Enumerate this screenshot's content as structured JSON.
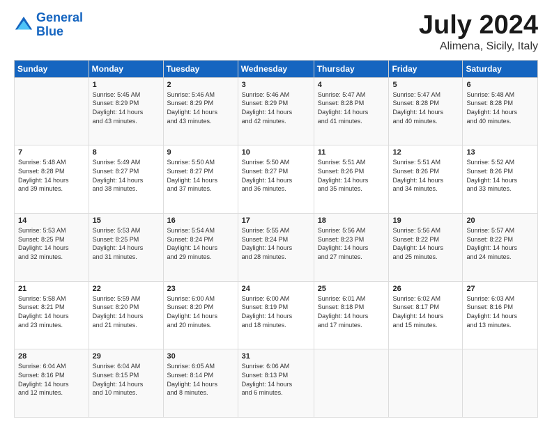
{
  "header": {
    "logo_line1": "General",
    "logo_line2": "Blue",
    "title": "July 2024",
    "subtitle": "Alimena, Sicily, Italy"
  },
  "weekdays": [
    "Sunday",
    "Monday",
    "Tuesday",
    "Wednesday",
    "Thursday",
    "Friday",
    "Saturday"
  ],
  "weeks": [
    [
      {
        "day": "",
        "text": ""
      },
      {
        "day": "1",
        "text": "Sunrise: 5:45 AM\nSunset: 8:29 PM\nDaylight: 14 hours\nand 43 minutes."
      },
      {
        "day": "2",
        "text": "Sunrise: 5:46 AM\nSunset: 8:29 PM\nDaylight: 14 hours\nand 43 minutes."
      },
      {
        "day": "3",
        "text": "Sunrise: 5:46 AM\nSunset: 8:29 PM\nDaylight: 14 hours\nand 42 minutes."
      },
      {
        "day": "4",
        "text": "Sunrise: 5:47 AM\nSunset: 8:28 PM\nDaylight: 14 hours\nand 41 minutes."
      },
      {
        "day": "5",
        "text": "Sunrise: 5:47 AM\nSunset: 8:28 PM\nDaylight: 14 hours\nand 40 minutes."
      },
      {
        "day": "6",
        "text": "Sunrise: 5:48 AM\nSunset: 8:28 PM\nDaylight: 14 hours\nand 40 minutes."
      }
    ],
    [
      {
        "day": "7",
        "text": "Sunrise: 5:48 AM\nSunset: 8:28 PM\nDaylight: 14 hours\nand 39 minutes."
      },
      {
        "day": "8",
        "text": "Sunrise: 5:49 AM\nSunset: 8:27 PM\nDaylight: 14 hours\nand 38 minutes."
      },
      {
        "day": "9",
        "text": "Sunrise: 5:50 AM\nSunset: 8:27 PM\nDaylight: 14 hours\nand 37 minutes."
      },
      {
        "day": "10",
        "text": "Sunrise: 5:50 AM\nSunset: 8:27 PM\nDaylight: 14 hours\nand 36 minutes."
      },
      {
        "day": "11",
        "text": "Sunrise: 5:51 AM\nSunset: 8:26 PM\nDaylight: 14 hours\nand 35 minutes."
      },
      {
        "day": "12",
        "text": "Sunrise: 5:51 AM\nSunset: 8:26 PM\nDaylight: 14 hours\nand 34 minutes."
      },
      {
        "day": "13",
        "text": "Sunrise: 5:52 AM\nSunset: 8:26 PM\nDaylight: 14 hours\nand 33 minutes."
      }
    ],
    [
      {
        "day": "14",
        "text": "Sunrise: 5:53 AM\nSunset: 8:25 PM\nDaylight: 14 hours\nand 32 minutes."
      },
      {
        "day": "15",
        "text": "Sunrise: 5:53 AM\nSunset: 8:25 PM\nDaylight: 14 hours\nand 31 minutes."
      },
      {
        "day": "16",
        "text": "Sunrise: 5:54 AM\nSunset: 8:24 PM\nDaylight: 14 hours\nand 29 minutes."
      },
      {
        "day": "17",
        "text": "Sunrise: 5:55 AM\nSunset: 8:24 PM\nDaylight: 14 hours\nand 28 minutes."
      },
      {
        "day": "18",
        "text": "Sunrise: 5:56 AM\nSunset: 8:23 PM\nDaylight: 14 hours\nand 27 minutes."
      },
      {
        "day": "19",
        "text": "Sunrise: 5:56 AM\nSunset: 8:22 PM\nDaylight: 14 hours\nand 25 minutes."
      },
      {
        "day": "20",
        "text": "Sunrise: 5:57 AM\nSunset: 8:22 PM\nDaylight: 14 hours\nand 24 minutes."
      }
    ],
    [
      {
        "day": "21",
        "text": "Sunrise: 5:58 AM\nSunset: 8:21 PM\nDaylight: 14 hours\nand 23 minutes."
      },
      {
        "day": "22",
        "text": "Sunrise: 5:59 AM\nSunset: 8:20 PM\nDaylight: 14 hours\nand 21 minutes."
      },
      {
        "day": "23",
        "text": "Sunrise: 6:00 AM\nSunset: 8:20 PM\nDaylight: 14 hours\nand 20 minutes."
      },
      {
        "day": "24",
        "text": "Sunrise: 6:00 AM\nSunset: 8:19 PM\nDaylight: 14 hours\nand 18 minutes."
      },
      {
        "day": "25",
        "text": "Sunrise: 6:01 AM\nSunset: 8:18 PM\nDaylight: 14 hours\nand 17 minutes."
      },
      {
        "day": "26",
        "text": "Sunrise: 6:02 AM\nSunset: 8:17 PM\nDaylight: 14 hours\nand 15 minutes."
      },
      {
        "day": "27",
        "text": "Sunrise: 6:03 AM\nSunset: 8:16 PM\nDaylight: 14 hours\nand 13 minutes."
      }
    ],
    [
      {
        "day": "28",
        "text": "Sunrise: 6:04 AM\nSunset: 8:16 PM\nDaylight: 14 hours\nand 12 minutes."
      },
      {
        "day": "29",
        "text": "Sunrise: 6:04 AM\nSunset: 8:15 PM\nDaylight: 14 hours\nand 10 minutes."
      },
      {
        "day": "30",
        "text": "Sunrise: 6:05 AM\nSunset: 8:14 PM\nDaylight: 14 hours\nand 8 minutes."
      },
      {
        "day": "31",
        "text": "Sunrise: 6:06 AM\nSunset: 8:13 PM\nDaylight: 14 hours\nand 6 minutes."
      },
      {
        "day": "",
        "text": ""
      },
      {
        "day": "",
        "text": ""
      },
      {
        "day": "",
        "text": ""
      }
    ]
  ]
}
